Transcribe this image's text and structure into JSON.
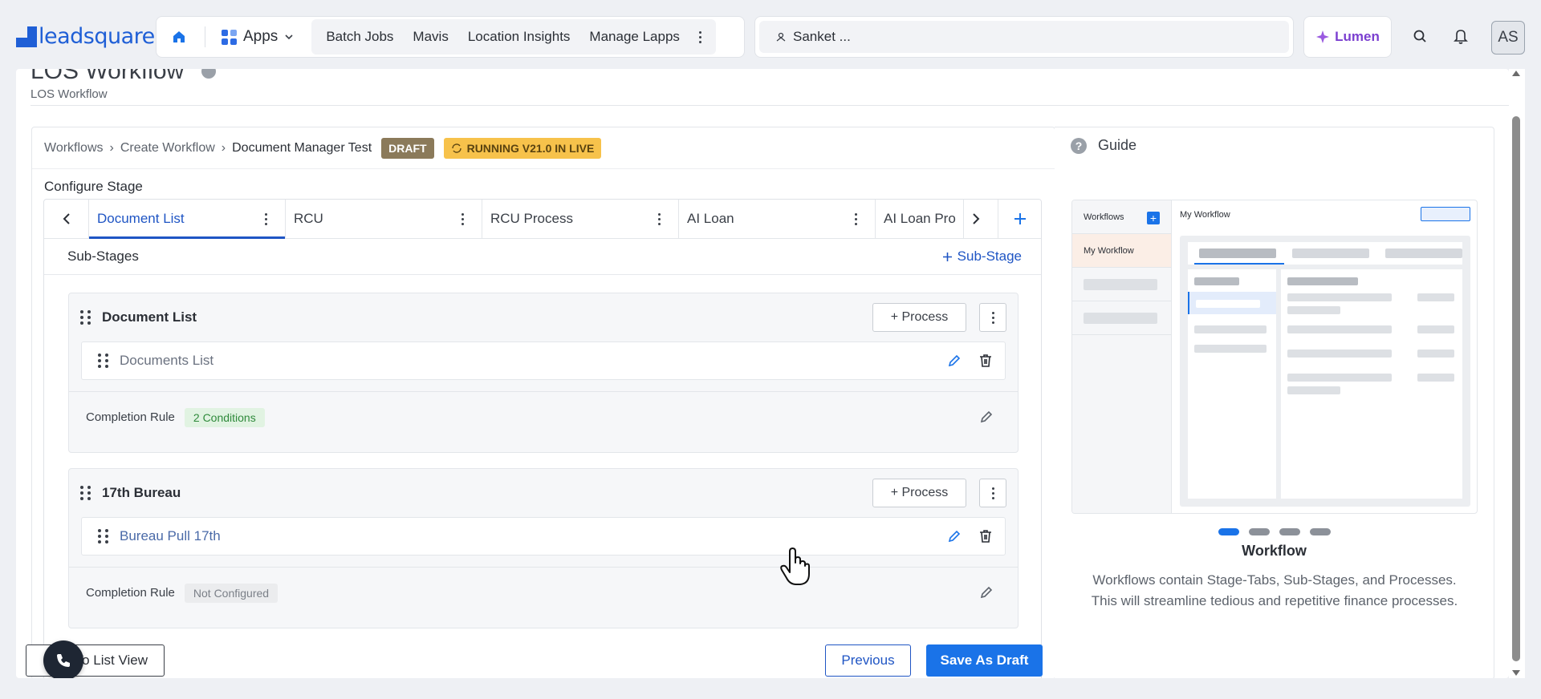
{
  "topbar": {
    "logo_text": "leadsquared",
    "apps_label": "Apps",
    "quick_links": [
      "Batch Jobs",
      "Mavis",
      "Location Insights",
      "Manage Lapps"
    ],
    "search_text": "Sanket ...",
    "lumen_label": "Lumen",
    "avatar_initials": "AS"
  },
  "page": {
    "title": "LOS Workflow",
    "subtitle": "LOS Workflow"
  },
  "breadcrumb": {
    "items": [
      "Workflows",
      "Create Workflow"
    ],
    "current": "Document Manager Test",
    "draft_badge": "DRAFT",
    "running_badge": "RUNNING V21.0 IN LIVE"
  },
  "configure": {
    "title": "Configure Stage",
    "tabs": [
      "Document List",
      "RCU",
      "RCU Process",
      "AI Loan",
      "AI Loan Pro"
    ],
    "active_tab": 0,
    "substages_label": "Sub-Stages",
    "add_substage_label": "Sub-Stage",
    "substages": [
      {
        "title": "Document List",
        "process_btn": "+ Process",
        "process_name": "Documents List",
        "rule_label": "Completion Rule",
        "rule_value": "2 Conditions"
      },
      {
        "title": "17th Bureau",
        "process_btn": "+ Process",
        "process_name": "Bureau Pull 17th",
        "rule_label": "Completion Rule",
        "rule_value": "Not Configured"
      }
    ]
  },
  "footer": {
    "list_view_label": "To List View",
    "previous_label": "Previous",
    "save_label": "Save As Draft"
  },
  "guide": {
    "title": "Guide",
    "illus_sidebar_title": "Workflows",
    "illus_sidebar_item": "My Workflow",
    "illus_main_title": "My Workflow",
    "step_title": "Workflow",
    "description": "Workflows contain Stage-Tabs, Sub-Stages, and Processes. This will streamline tedious and repetitive finance processes.",
    "active_step": 1,
    "total_steps": 4
  },
  "colors": {
    "brand_blue": "#1f5fd6",
    "primary_button": "#1a73e8",
    "draft_badge": "#8b7a5a",
    "running_badge": "#f7c24b",
    "lumen": "#7b3fd0"
  }
}
